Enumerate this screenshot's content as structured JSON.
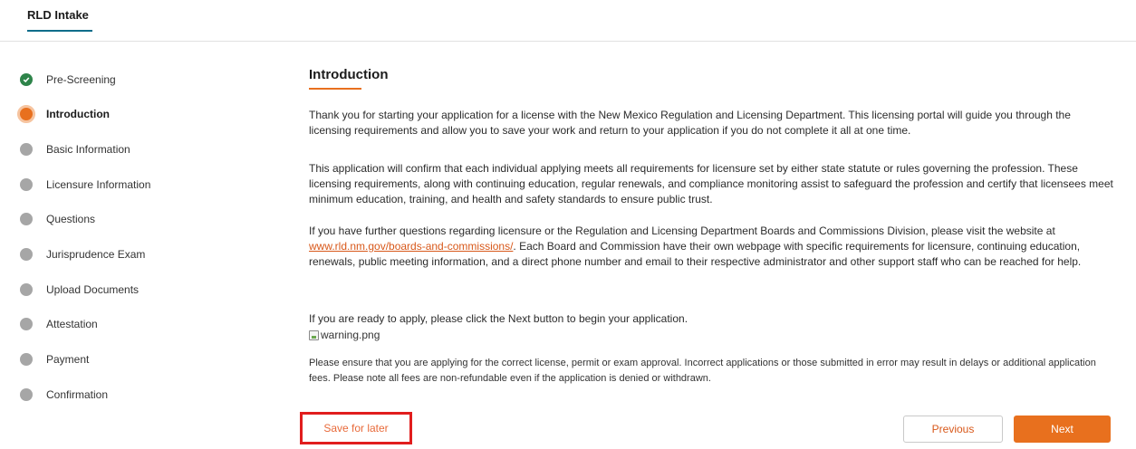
{
  "tab": {
    "label": "RLD Intake"
  },
  "steps": [
    {
      "label": "Pre-Screening",
      "state": "done"
    },
    {
      "label": "Introduction",
      "state": "active"
    },
    {
      "label": "Basic Information",
      "state": "pending"
    },
    {
      "label": "Licensure Information",
      "state": "pending"
    },
    {
      "label": "Questions",
      "state": "pending"
    },
    {
      "label": "Jurisprudence Exam",
      "state": "pending"
    },
    {
      "label": "Upload Documents",
      "state": "pending"
    },
    {
      "label": "Attestation",
      "state": "pending"
    },
    {
      "label": "Payment",
      "state": "pending"
    },
    {
      "label": "Confirmation",
      "state": "pending"
    }
  ],
  "main": {
    "title": "Introduction",
    "para1": "Thank you for starting your application for a license with the New Mexico Regulation and Licensing Department. This licensing portal will guide you through the licensing requirements and allow you to save your work and return to your application if you do not complete it all at one time.",
    "para2": "This application will confirm that each individual applying meets all requirements for licensure set by either state statute or rules governing the profession. These licensing requirements, along with continuing education, regular renewals, and compliance monitoring assist to safeguard the profession and certify that licensees meet minimum education, training, and health and safety standards to ensure public trust.",
    "para3_before": "If you have further questions regarding licensure or the Regulation and Licensing Department Boards and Commissions Division, please visit the website at ",
    "para3_link": "www.rld.nm.gov/boards-and-commissions/",
    "para3_after": ". Each Board and Commission have their own webpage with specific requirements for licensure, continuing education, renewals, public meeting information, and a direct phone number and email to their respective administrator and other support staff who can be reached for help.",
    "para4": "If you are ready to apply, please click the Next button to begin your application.",
    "image_alt": "warning.png",
    "notice": "Please ensure that you are applying for the correct license, permit or exam approval. Incorrect applications or those submitted in error may result in delays or additional application fees. Please note all fees are non-refundable even if the application is denied or withdrawn."
  },
  "buttons": {
    "save": "Save for later",
    "previous": "Previous",
    "next": "Next"
  },
  "colors": {
    "accent": "#e8701e",
    "done": "#2e844a",
    "pending": "#a6a6a6",
    "highlight": "#e11d1d"
  }
}
